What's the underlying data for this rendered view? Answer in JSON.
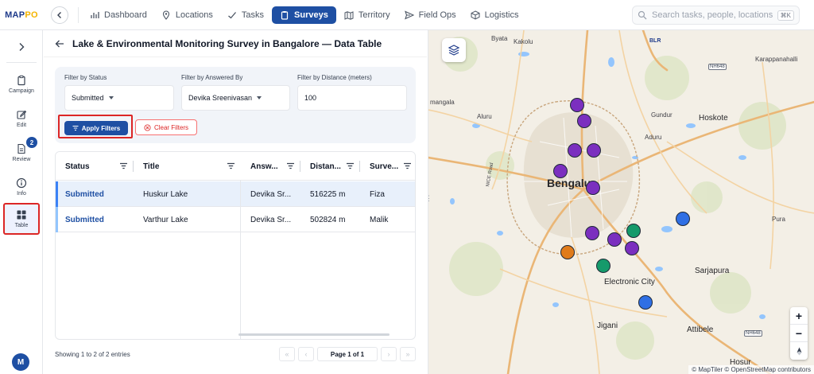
{
  "app": {
    "logo_text": "MAP",
    "logo_accent": "PO"
  },
  "nav": {
    "tabs": [
      {
        "label": "Dashboard",
        "icon": "bar-chart-icon"
      },
      {
        "label": "Locations",
        "icon": "map-pin-icon"
      },
      {
        "label": "Tasks",
        "icon": "check-icon"
      },
      {
        "label": "Surveys",
        "icon": "clipboard-icon",
        "active": true
      },
      {
        "label": "Territory",
        "icon": "map-icon"
      },
      {
        "label": "Field Ops",
        "icon": "send-icon"
      },
      {
        "label": "Logistics",
        "icon": "box-icon"
      }
    ]
  },
  "search": {
    "placeholder": "Search tasks, people, locations...",
    "shortcut": "⌘K"
  },
  "rail": {
    "items": [
      {
        "label": "Campaign",
        "icon": "clipboard-icon"
      },
      {
        "label": "Edit",
        "icon": "edit-icon"
      },
      {
        "label": "Review",
        "icon": "document-icon",
        "badge": "2"
      },
      {
        "label": "Info",
        "icon": "info-icon"
      },
      {
        "label": "Table",
        "icon": "grid-icon",
        "active": true
      }
    ],
    "avatar_initial": "M"
  },
  "panel": {
    "title": "Lake & Environmental Monitoring Survey in Bangalore — Data Table"
  },
  "filters": {
    "status_label": "Filter by Status",
    "status_value": "Submitted",
    "answered_label": "Filter by Answered By",
    "answered_value": "Devika Sreenivasan",
    "distance_label": "Filter by Distance (meters)",
    "distance_value": "100",
    "apply_label": "Apply Filters",
    "clear_label": "Clear Filters"
  },
  "table": {
    "columns": [
      "Status",
      "Title",
      "Answ...",
      "Distan...",
      "Surve..."
    ],
    "rows": [
      {
        "status": "Submitted",
        "title": "Huskur Lake",
        "answered": "Devika Sr...",
        "distance": "516225 m",
        "surveyor": "Fiza"
      },
      {
        "status": "Submitted",
        "title": "Varthur Lake",
        "answered": "Devika Sr...",
        "distance": "502824 m",
        "surveyor": "Malik"
      }
    ]
  },
  "footer": {
    "info": "Showing 1 to 2 of 2 entries",
    "page_info": "Page 1 of 1"
  },
  "map": {
    "labels": {
      "byata": "Byata",
      "kakolu": "Kakolu",
      "blr": "BLR",
      "karappanahalli": "Karappanahalli",
      "mangala": "mangala",
      "aluru": "Aluru",
      "gunduru": "Gundur",
      "hoskote": "Hoskote",
      "aduru": "Aduru",
      "bengaluru": "Bengalu",
      "nice_road": "NICE Road",
      "puraa": "Pura",
      "sarjapura": "Sarjapura",
      "electronic_city": "Electronic City",
      "jigani": "Jigani",
      "attibele": "Attibele",
      "hosur": "Hosur"
    },
    "shields": [
      "NH648",
      "NH648"
    ],
    "attribution": "© MapTiler © OpenStreetMap contributors",
    "marker_colors": {
      "purple": "#7b2fbf",
      "green": "#159a6b",
      "blue": "#2f6fe4",
      "orange": "#e07b1a"
    }
  }
}
